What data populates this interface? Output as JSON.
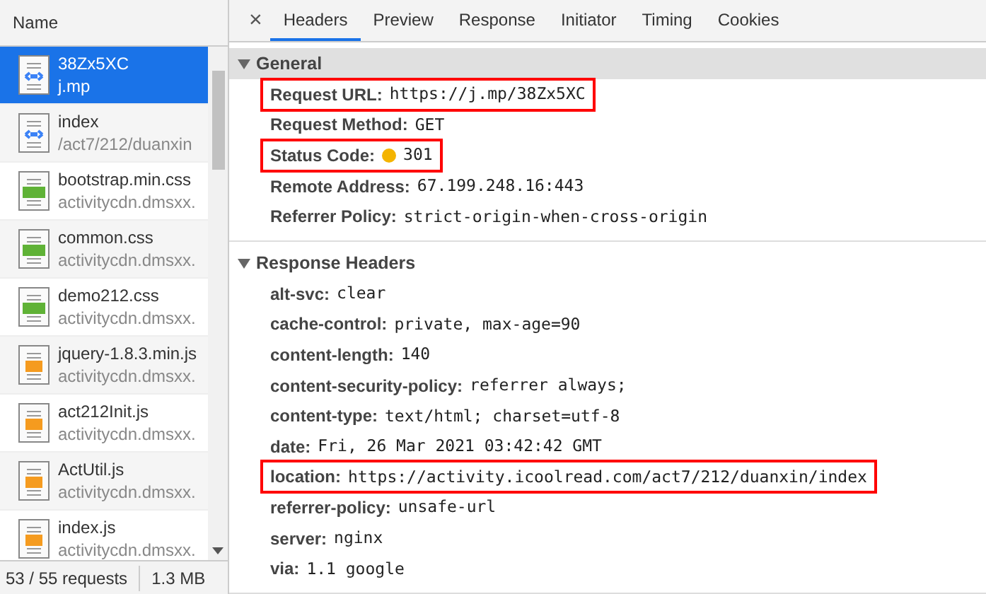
{
  "requests": {
    "column": "Name",
    "items": [
      {
        "name": "38Zx5XC",
        "path": "j.mp",
        "kind": "doc",
        "selected": true
      },
      {
        "name": "index",
        "path": "/act7/212/duanxin",
        "kind": "doc",
        "selected": false
      },
      {
        "name": "bootstrap.min.css",
        "path": "activitycdn.dmsxx.",
        "kind": "css",
        "selected": false
      },
      {
        "name": "common.css",
        "path": "activitycdn.dmsxx.",
        "kind": "css",
        "selected": false
      },
      {
        "name": "demo212.css",
        "path": "activitycdn.dmsxx.",
        "kind": "css",
        "selected": false
      },
      {
        "name": "jquery-1.8.3.min.js",
        "path": "activitycdn.dmsxx.",
        "kind": "js",
        "selected": false
      },
      {
        "name": "act212Init.js",
        "path": "activitycdn.dmsxx.",
        "kind": "js",
        "selected": false
      },
      {
        "name": "ActUtil.js",
        "path": "activitycdn.dmsxx.",
        "kind": "js",
        "selected": false
      },
      {
        "name": "index.js",
        "path": "activitycdn.dmsxx.",
        "kind": "js",
        "selected": false
      }
    ],
    "status_bar": {
      "count": "53 / 55 requests",
      "size": "1.3 MB"
    }
  },
  "details": {
    "close": "×",
    "tabs": [
      {
        "label": "Headers",
        "selected": true
      },
      {
        "label": "Preview",
        "selected": false
      },
      {
        "label": "Response",
        "selected": false
      },
      {
        "label": "Initiator",
        "selected": false
      },
      {
        "label": "Timing",
        "selected": false
      },
      {
        "label": "Cookies",
        "selected": false
      }
    ],
    "sections": [
      {
        "title": "General",
        "expanded": true,
        "rows": [
          {
            "key": "Request URL:",
            "value": "https://j.mp/38Zx5XC",
            "highlighted": true
          },
          {
            "key": "Request Method:",
            "value": "GET",
            "highlighted": false
          },
          {
            "key": "Status Code:",
            "value": "301",
            "highlighted": true,
            "color": "#f4b400"
          },
          {
            "key": "Remote Address:",
            "value": "67.199.248.16:443",
            "highlighted": false
          },
          {
            "key": "Referrer Policy:",
            "value": "strict-origin-when-cross-origin",
            "highlighted": false
          }
        ]
      },
      {
        "title": "Response Headers",
        "expanded": true,
        "rows": [
          {
            "key": "alt-svc:",
            "value": "clear",
            "highlighted": false
          },
          {
            "key": "cache-control:",
            "value": "private, max-age=90",
            "highlighted": false
          },
          {
            "key": "content-length:",
            "value": "140",
            "highlighted": false
          },
          {
            "key": "content-security-policy:",
            "value": "referrer always;",
            "highlighted": false
          },
          {
            "key": "content-type:",
            "value": "text/html; charset=utf-8",
            "highlighted": false
          },
          {
            "key": "date:",
            "value": "Fri, 26 Mar 2021 03:42:42 GMT",
            "highlighted": false
          },
          {
            "key": "location:",
            "value": "https://activity.icoolread.com/act7/212/duanxin/index",
            "highlighted": true
          },
          {
            "key": "referrer-policy:",
            "value": "unsafe-url",
            "highlighted": false
          },
          {
            "key": "server:",
            "value": "nginx",
            "highlighted": false
          },
          {
            "key": "via:",
            "value": "1.1 google",
            "highlighted": false
          }
        ]
      }
    ]
  }
}
